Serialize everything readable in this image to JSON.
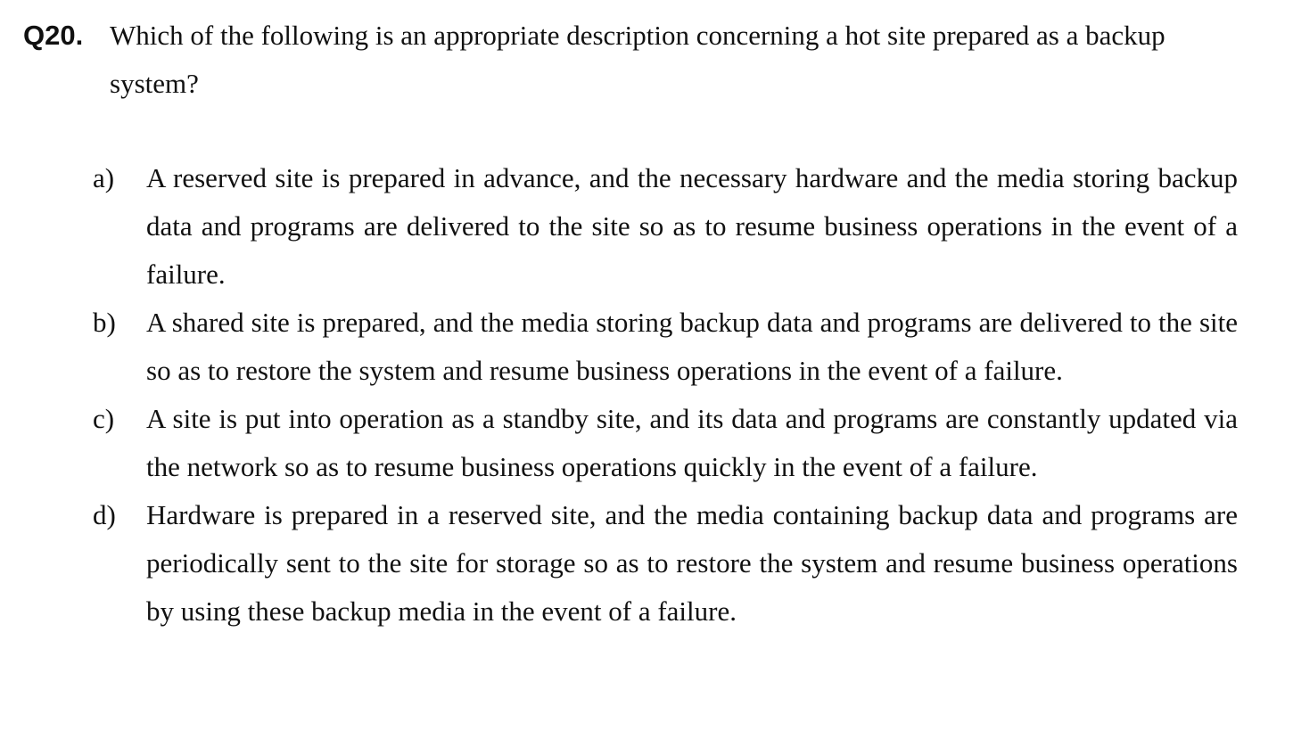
{
  "question": {
    "number": "Q20.",
    "text": "Which of the following is an appropriate description concerning a hot site prepared as a backup system?"
  },
  "options": [
    {
      "label": "a)",
      "text": "A reserved site is prepared in advance, and the necessary hardware and the media storing backup data and programs are delivered to the site so as to resume business operations in the event of a failure."
    },
    {
      "label": "b)",
      "text": "A shared site is prepared, and the media storing backup data and programs are delivered to the site so as to restore the system and resume business operations in the event of a failure."
    },
    {
      "label": "c)",
      "text": "A site is put into operation as a standby site, and its data and programs are constantly updated via the network so as to resume business operations quickly in the event of a failure."
    },
    {
      "label": "d)",
      "text": "Hardware is prepared in a reserved site, and the media containing backup data and programs are periodically sent to the site for storage so as to restore the system and resume business operations by using these backup media in the event of a failure."
    }
  ]
}
